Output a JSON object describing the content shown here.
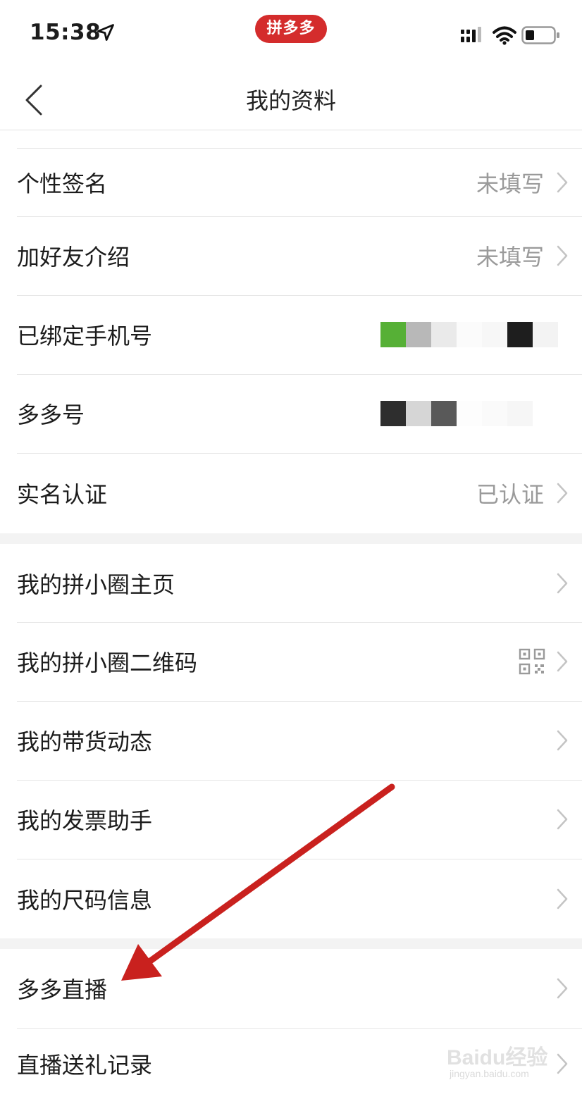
{
  "status_bar": {
    "time": "15:38",
    "app_badge": "拼多多",
    "icons": [
      "location-arrow-icon",
      "signal-icon",
      "wifi-icon",
      "battery-icon"
    ]
  },
  "nav": {
    "title": "我的资料",
    "back_icon": "chevron-left-icon"
  },
  "section1": [
    {
      "label": "个性签名",
      "value": "未填写"
    },
    {
      "label": "加好友介绍",
      "value": "未填写"
    },
    {
      "label": "已绑定手机号",
      "value": ""
    },
    {
      "label": "多多号",
      "value": ""
    },
    {
      "label": "实名认证",
      "value": "已认证"
    }
  ],
  "section2": [
    {
      "label": "我的拼小圈主页"
    },
    {
      "label": "我的拼小圈二维码",
      "icon": "qr-code-icon"
    },
    {
      "label": "我的带货动态"
    },
    {
      "label": "我的发票助手"
    },
    {
      "label": "我的尺码信息"
    }
  ],
  "section3": [
    {
      "label": "多多直播"
    },
    {
      "label": "直播送礼记录"
    }
  ],
  "annotation": {
    "type": "red-arrow",
    "color": "#c9211e",
    "points_to": "多多直播"
  },
  "watermark": {
    "brand": "Baidu经验",
    "url": "jingyan.baidu.com"
  },
  "colors": {
    "accent_red": "#d42c2c",
    "value_gray": "#9a9a9a",
    "section_gap": "#f3f3f3"
  }
}
